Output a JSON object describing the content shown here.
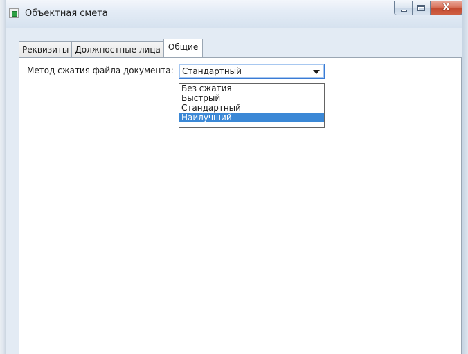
{
  "window": {
    "title": "Объектная смета",
    "controls": {
      "minimize": "minimize",
      "maximize": "maximize",
      "close": "X"
    }
  },
  "tabs": [
    {
      "label": "Реквизиты",
      "active": false
    },
    {
      "label": "Должностные лица",
      "active": false
    },
    {
      "label": "Общие",
      "active": true
    }
  ],
  "general": {
    "compression_label": "Метод сжатия файла документа:",
    "compression_value": "Стандартный",
    "compression_options": [
      "Без сжатия",
      "Быстрый",
      "Стандартный",
      "Наилучший"
    ],
    "highlighted_option": "Наилучший"
  },
  "colors": {
    "selection": "#3b88d6",
    "close_button": "#c24a30",
    "focus_border": "#3a7bd5"
  }
}
